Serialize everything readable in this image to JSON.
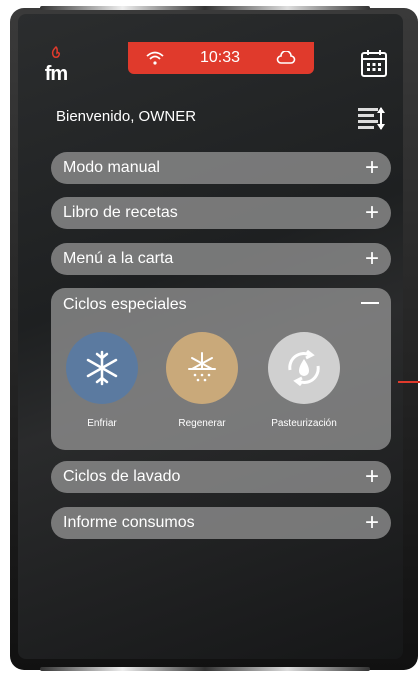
{
  "header": {
    "logo_text": "fm",
    "time": "10:33",
    "accent_color": "#e03a2c"
  },
  "welcome": "Bienvenido, OWNER",
  "menu": {
    "modo_manual": "Modo manual",
    "libro_recetas": "Libro de recetas",
    "menu_carta": "Menú a la carta",
    "ciclos_especiales": "Ciclos especiales",
    "ciclos_lavado": "Ciclos de lavado",
    "informe_consumos": "Informe consumos"
  },
  "cycles": {
    "enfriar": "Enfriar",
    "regenerar": "Regenerar",
    "pasteurizacion": "Pasteurización"
  },
  "icons": {
    "plus": "+",
    "minus": "−"
  }
}
